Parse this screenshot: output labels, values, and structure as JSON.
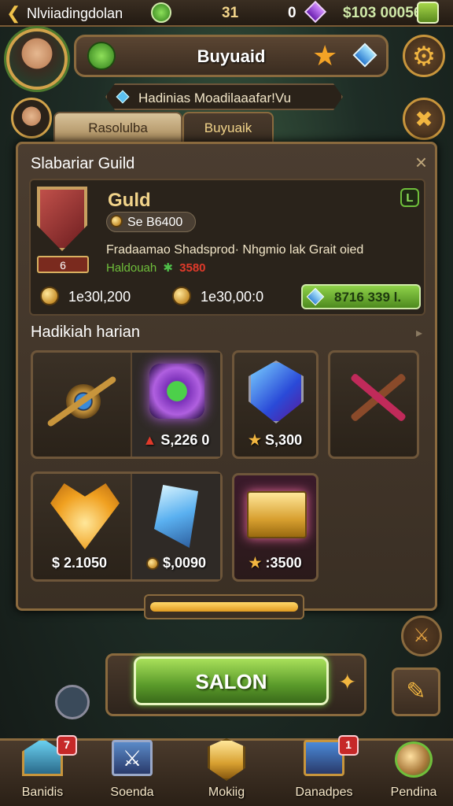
{
  "top_bar": {
    "player_name": "Nlviiadingdolan",
    "energy": "31",
    "gems": "0",
    "gold": "$103 00056"
  },
  "profile_banner": {
    "title": "Buyuaid"
  },
  "subtitle_bar": {
    "text": "Hadinias Moadilaaafar!Vu"
  },
  "tabs": [
    {
      "label": "Rasolulba"
    },
    {
      "label": "Buyuaik"
    }
  ],
  "panel": {
    "header": "Slabariar Guild",
    "close_glyph": "×",
    "guild": {
      "name": "Guld",
      "level_badge": "L",
      "crest_rank": "6",
      "cost": "Se B6400",
      "description": "Fradaamao Shadsprod·  Nhgmio lak Grait oied",
      "reward_label": "Haldouah",
      "reward_value": "3580",
      "reward_icon": "✱",
      "stat1": "1e30l,200",
      "stat2": "1e30,00:0",
      "buy_value": "8716 339 l."
    },
    "section_title": "Hadikiah harian",
    "items": [
      {
        "icon": "compass-staff-icon",
        "price": ""
      },
      {
        "icon": "green-gem-icon",
        "price": "S,226 0"
      },
      {
        "icon": "blue-shield-icon",
        "price": "S,300"
      },
      {
        "icon": "crossbow-icon",
        "price": ""
      },
      {
        "icon": "gold-fan-icon",
        "price": "$ 2.1050"
      },
      {
        "icon": "crystal-axe-icon",
        "price": "$,0090"
      },
      {
        "icon": "gold-chest-icon",
        "price": ":3500"
      }
    ]
  },
  "main_button": {
    "label": "SALON"
  },
  "bottom_nav": [
    {
      "label": "Banidis",
      "badge": "7"
    },
    {
      "label": "Soenda",
      "badge": ""
    },
    {
      "label": "Mokiig",
      "badge": ""
    },
    {
      "label": "Danadpes",
      "badge": "1"
    },
    {
      "label": "Pendina",
      "badge": ""
    }
  ],
  "colors": {
    "wood": "#4a3a2c",
    "gold": "#f2d48a",
    "green": "#6fbf3b",
    "red_badge": "#c62828"
  }
}
